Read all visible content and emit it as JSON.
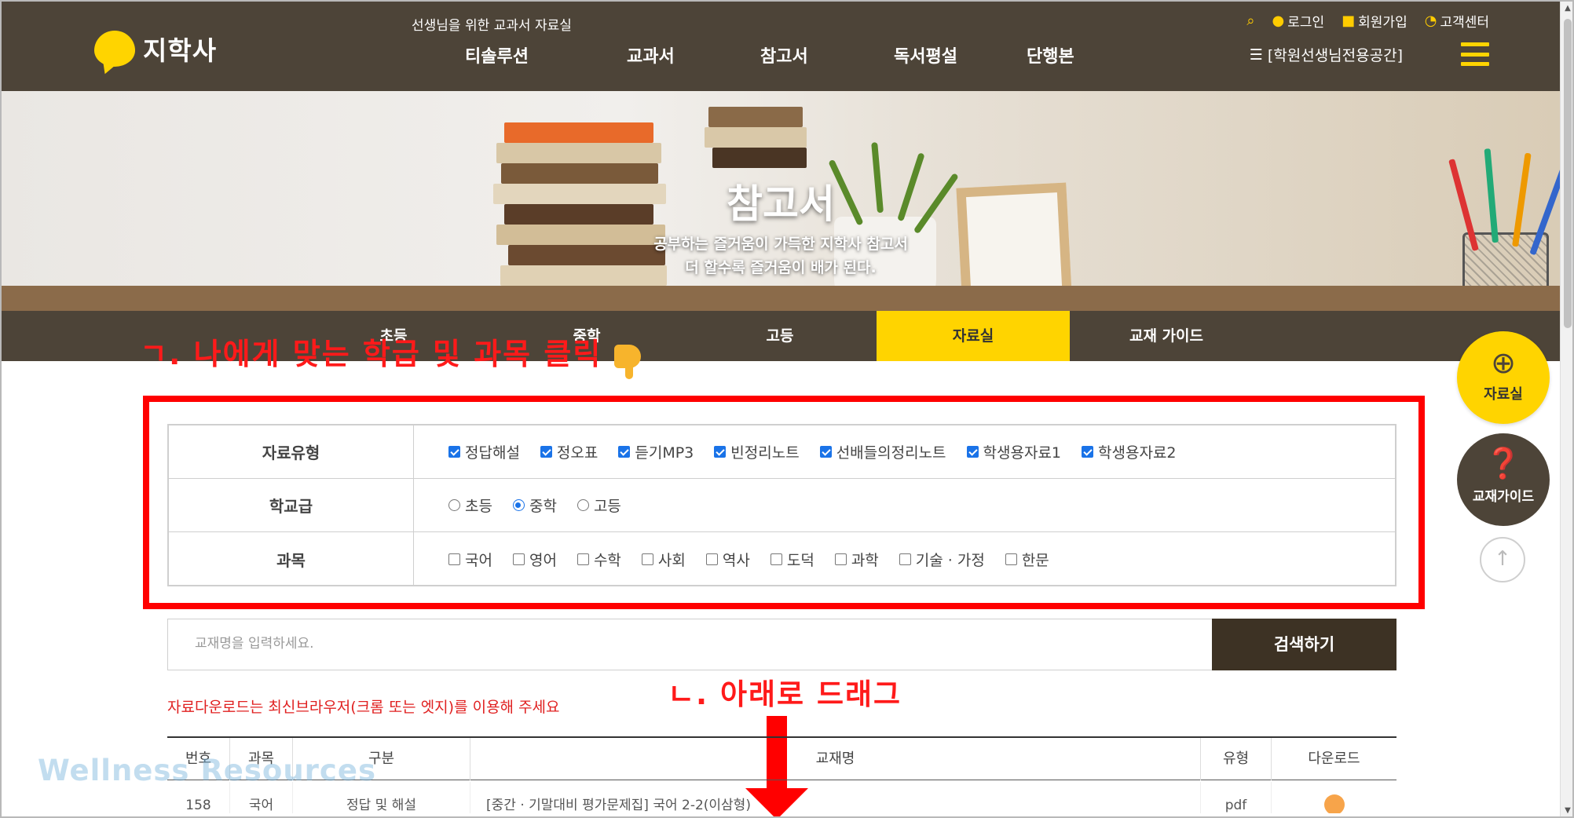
{
  "header": {
    "logo_text": "지학사",
    "tagline": "선생님을 위한 교과서 자료실",
    "nav": [
      "티솔루션",
      "교과서",
      "참고서",
      "독서평설",
      "단행본"
    ],
    "utility": [
      {
        "label": "로그인",
        "icon": "user-icon"
      },
      {
        "label": "회원가입",
        "icon": "lock-icon"
      },
      {
        "label": "고객센터",
        "icon": "headset-icon"
      }
    ],
    "academy_link": "[학원선생님전용공간]",
    "accent_color": "#ffd400",
    "bg_color": "#4d4438"
  },
  "hero": {
    "title": "참고서",
    "subtitle_line1": "공부하는 즐거움이 가득한 지학사 참고서",
    "subtitle_line2": "더 할수록 즐거움이 배가 된다."
  },
  "tabs": [
    {
      "label": "초등",
      "active": false
    },
    {
      "label": "중학",
      "active": false
    },
    {
      "label": "고등",
      "active": false
    },
    {
      "label": "자료실",
      "active": true
    },
    {
      "label": "교재 가이드",
      "active": false
    }
  ],
  "annotations": {
    "step1": "ㄱ. 나에게 맞는 학급 및 과목 클릭",
    "step2": "ㄴ. 아래로 드래그"
  },
  "filters": {
    "type": {
      "label": "자료유형",
      "options": [
        {
          "label": "정답해설",
          "checked": true
        },
        {
          "label": "정오표",
          "checked": true
        },
        {
          "label": "듣기MP3",
          "checked": true
        },
        {
          "label": "빈정리노트",
          "checked": true
        },
        {
          "label": "선배들의정리노트",
          "checked": true
        },
        {
          "label": "학생용자료1",
          "checked": true
        },
        {
          "label": "학생용자료2",
          "checked": true
        }
      ]
    },
    "level": {
      "label": "학교급",
      "options": [
        {
          "label": "초등",
          "selected": false
        },
        {
          "label": "중학",
          "selected": true
        },
        {
          "label": "고등",
          "selected": false
        }
      ]
    },
    "subject": {
      "label": "과목",
      "options": [
        {
          "label": "국어",
          "checked": false
        },
        {
          "label": "영어",
          "checked": false
        },
        {
          "label": "수학",
          "checked": false
        },
        {
          "label": "사회",
          "checked": false
        },
        {
          "label": "역사",
          "checked": false
        },
        {
          "label": "도덕",
          "checked": false
        },
        {
          "label": "과학",
          "checked": false
        },
        {
          "label": "기술 · 가정",
          "checked": false
        },
        {
          "label": "한문",
          "checked": false
        }
      ]
    }
  },
  "search": {
    "placeholder": "교재명을 입력하세요.",
    "button_label": "검색하기"
  },
  "notice": "자료다운로드는 최신브라우저(크롬 또는 엣지)를 이용해 주세요",
  "results": {
    "columns": [
      "번호",
      "과목",
      "구분",
      "교재명",
      "유형",
      "다운로드"
    ],
    "rows": [
      {
        "no": "158",
        "subject": "국어",
        "category": "정답 및 해설",
        "title": "[중간 · 기말대비 평가문제집] 국어 2-2(이삼형)",
        "type": "pdf",
        "download_icon": "pdf-icon"
      }
    ]
  },
  "watermark": "Wellness Resources",
  "floating": {
    "library_label": "자료실",
    "guide_label": "교재가이드"
  }
}
